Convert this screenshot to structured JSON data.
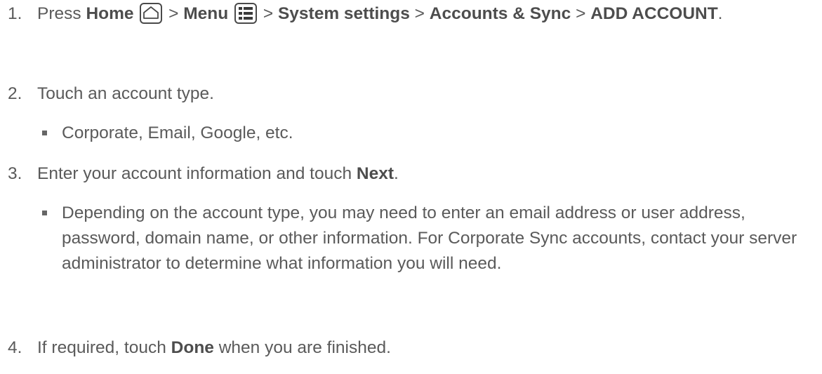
{
  "steps": [
    {
      "number": "1.",
      "press": "Press ",
      "home": "Home",
      "sep1": " > ",
      "menu": "Menu",
      "sep2": " > ",
      "system_settings": "System settings",
      "sep3": " > ",
      "accounts_sync": "Accounts & Sync",
      "sep4": " > ",
      "add_account": "ADD ACCOUNT",
      "end": "."
    },
    {
      "number": "2.",
      "text": "Touch an account type."
    },
    {
      "number": "3.",
      "pre": "Enter your account information and touch ",
      "next": "Next",
      "end": "."
    },
    {
      "number": "4.",
      "pre": "If required, touch ",
      "done": "Done",
      "post": " when you are finished."
    }
  ],
  "bullets": [
    "Corporate, Email, Google, etc.",
    "Depending on the account type, you may need to enter an email address or user address, password, domain name, or other information. For Corporate Sync accounts, contact your server administrator to determine what information you will need."
  ],
  "icons": {
    "home": "home-icon",
    "menu": "menu-icon"
  }
}
